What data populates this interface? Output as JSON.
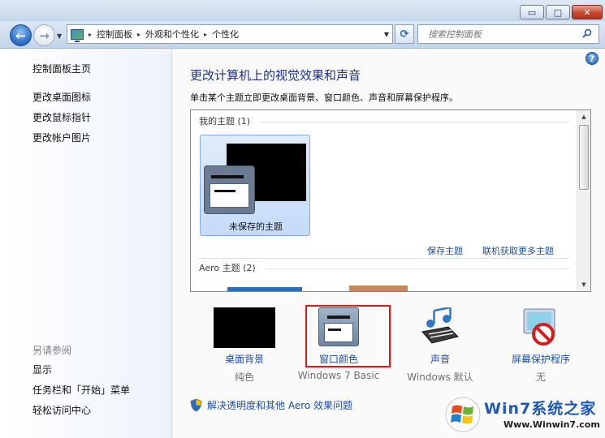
{
  "window": {
    "minimize_glyph": "▭",
    "maximize_glyph": "□",
    "close_glyph": "✕",
    "buttons": [
      "minimize",
      "maximize",
      "close"
    ]
  },
  "nav": {
    "back_glyph": "←",
    "forward_glyph": "→",
    "history_dropdown_glyph": "▼",
    "breadcrumbs": [
      "控制面板",
      "外观和个性化",
      "个性化"
    ],
    "breadcrumb_separator": "▸",
    "address_dropdown_glyph": "▼",
    "refresh_glyph": "⟳",
    "search_placeholder": "搜索控制面板"
  },
  "sidebar": {
    "home": "控制面板主页",
    "items": [
      "更改桌面图标",
      "更改鼠标指针",
      "更改帐户图片"
    ],
    "see_also_title": "另请参阅",
    "see_also": [
      "显示",
      "任务栏和「开始」菜单",
      "轻松访问中心"
    ]
  },
  "main": {
    "help_glyph": "?",
    "title": "更改计算机上的视觉效果和声音",
    "description": "单击某个主题立即更改桌面背景、窗口颜色、声音和屏幕保护程序。",
    "my_themes_header": "我的主题 (1)",
    "unsaved_theme_label": "未保存的主题",
    "save_theme_link": "保存主题",
    "get_more_themes_link": "联机获取更多主题",
    "aero_themes_header": "Aero 主题 (2)",
    "scroll_up_glyph": "▲",
    "scroll_down_glyph": "▼"
  },
  "options": [
    {
      "label": "桌面背景",
      "value": "纯色",
      "icon": "desktop-background-icon"
    },
    {
      "label": "窗口颜色",
      "value": "Windows 7 Basic",
      "icon": "window-color-icon"
    },
    {
      "label": "声音",
      "value": "Windows 默认",
      "icon": "music-notes-icon"
    },
    {
      "label": "屏幕保护程序",
      "value": "无",
      "icon": "no-screensaver-icon"
    }
  ],
  "aero_help_link": "解决透明度和其他 Aero 效果问题",
  "watermark": {
    "title": "Win7系统之家",
    "url": "Www.Winwin7.com"
  },
  "colors": {
    "accent_link": "#1c4fa7",
    "title_blue": "#1e3287",
    "highlight_red": "#e0161b",
    "close_red": "#c54a30"
  }
}
